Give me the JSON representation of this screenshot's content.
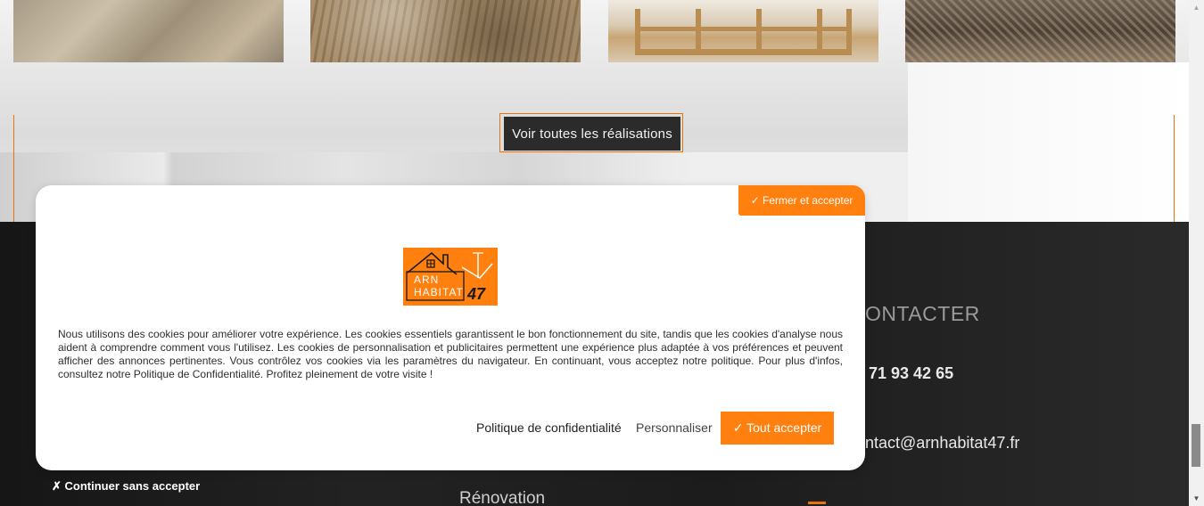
{
  "gallery": {
    "see_all_button": "Voir toutes les réalisations"
  },
  "footer": {
    "contact_title": "ONTACTER",
    "phone": "71 93 42 65",
    "email": "ontact@arnhabitat47.fr",
    "renovation_label": "Rénovation"
  },
  "cookie_banner": {
    "close_accept_label": "✓ Fermer et accepter",
    "logo": {
      "line1": "ARN",
      "line2": "HABITAT",
      "line3": "47"
    },
    "text": "Nous utilisons des cookies pour améliorer votre expérience. Les cookies essentiels garantissent le bon fonctionnement du site, tandis que les cookies d'analyse nous aident à comprendre comment vous l'utilisez. Les cookies de personnalisation et publicitaires permettent une expérience plus adaptée à vos préférences et peuvent afficher des annonces pertinentes. Vous contrôlez vos cookies via les paramètres du navigateur. En continuant, vous acceptez notre politique. Pour plus d'infos, consultez notre Politique de Confidentialité. Profitez pleinement de votre visite !",
    "policy_link": "Politique de confidentialité",
    "customize_link": "Personnaliser",
    "accept_all_label": "✓ Tout accepter",
    "continue_without_label": "✗ Continuer sans accepter"
  },
  "colors": {
    "accent": "#ff7f0f",
    "dark": "#2b2b2b"
  },
  "scrollbar": {
    "up_icon": "▲",
    "down_icon": "▼"
  }
}
